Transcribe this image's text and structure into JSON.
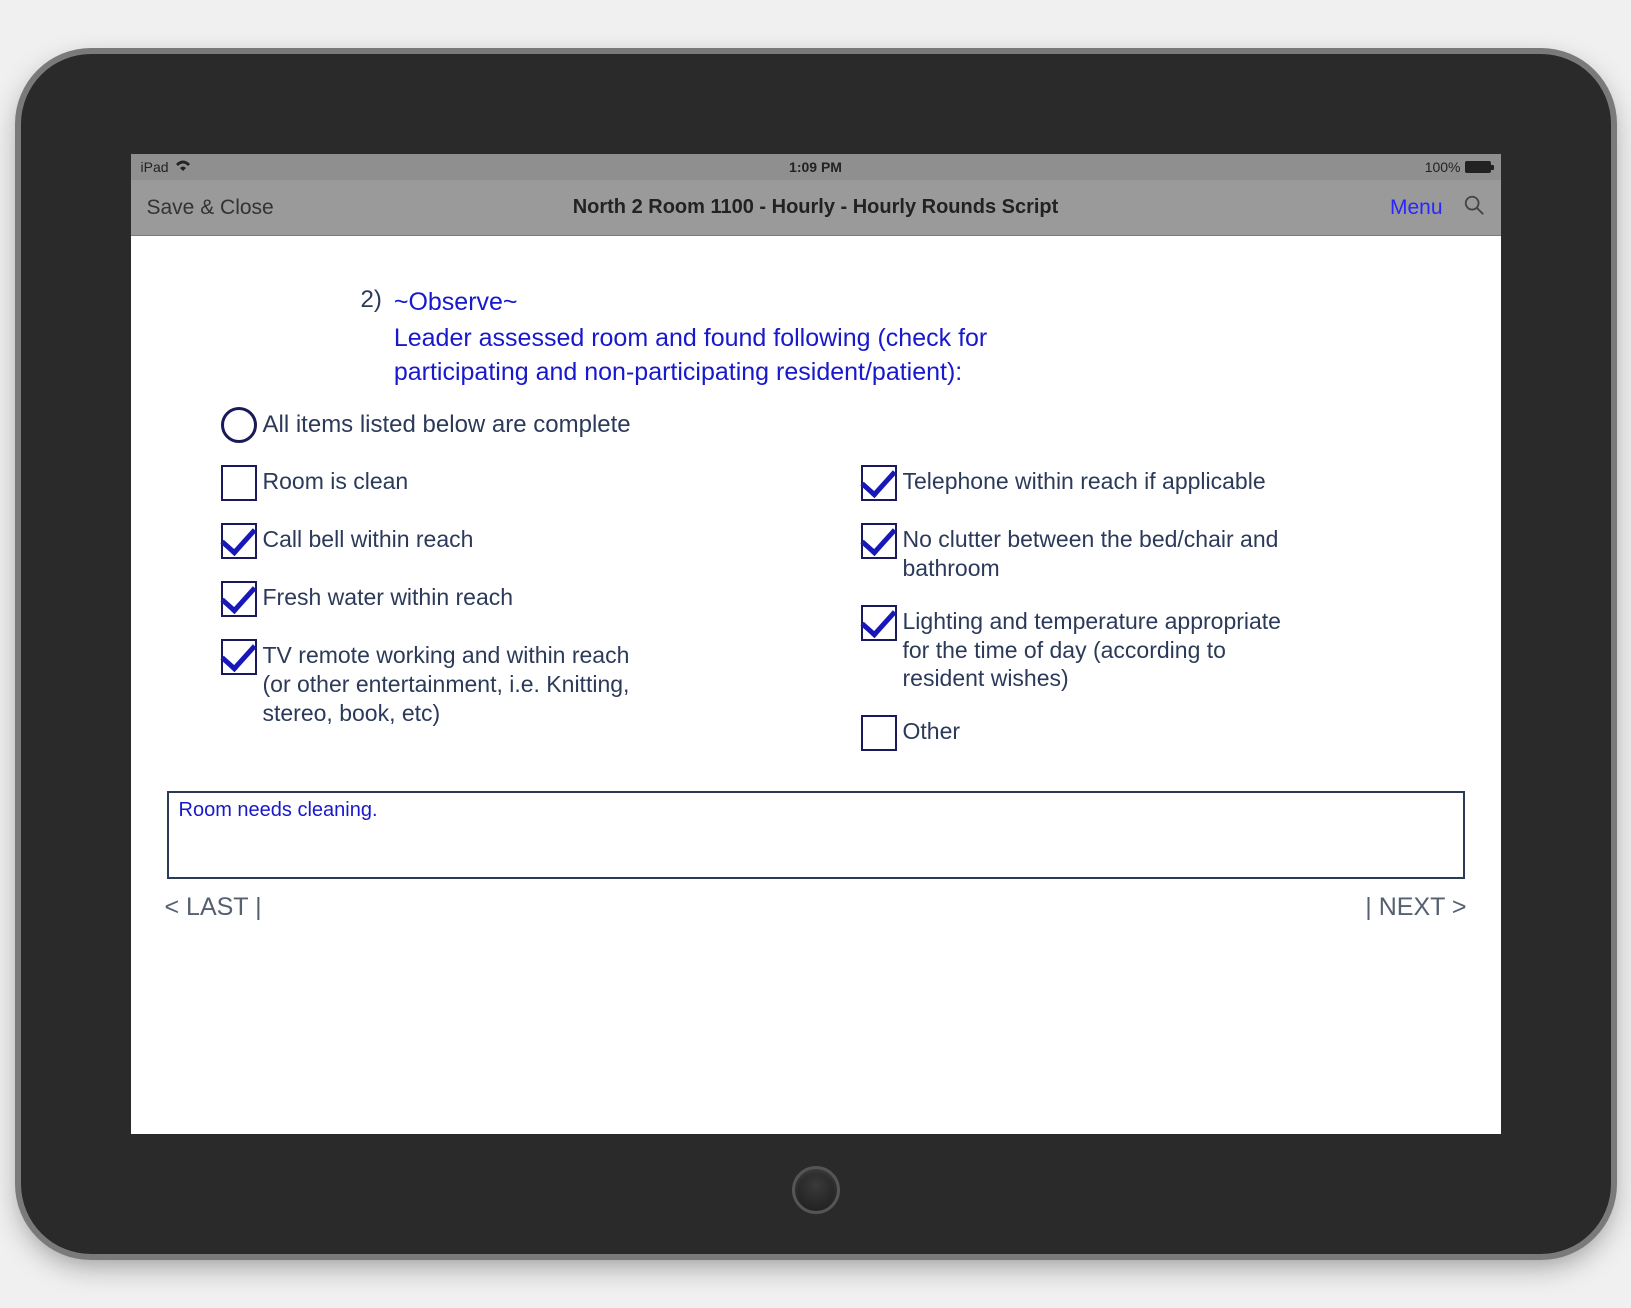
{
  "status": {
    "device": "iPad",
    "time": "1:09 PM",
    "battery": "100%"
  },
  "nav": {
    "save_close": "Save & Close",
    "title": "North 2 Room 1100  - Hourly - Hourly Rounds Script",
    "menu": "Menu"
  },
  "question": {
    "number": "2)",
    "heading": "~Observe~",
    "prompt": "Leader assessed room and found following (check for participating and non-participating resident/patient):"
  },
  "radio": {
    "all_complete": "All items listed below are complete",
    "checked": false
  },
  "checks_left": [
    {
      "label": "Room is clean",
      "checked": false
    },
    {
      "label": "Call bell within reach",
      "checked": true
    },
    {
      "label": "Fresh water within reach",
      "checked": true
    },
    {
      "label": "TV remote working and within reach (or other entertainment, i.e. Knitting, stereo, book, etc)",
      "checked": true
    }
  ],
  "checks_right": [
    {
      "label": "Telephone within reach if applicable",
      "checked": true
    },
    {
      "label": "No clutter between the bed/chair and bathroom",
      "checked": true
    },
    {
      "label": "Lighting and temperature appropriate for the time of day (according to resident wishes)",
      "checked": true
    },
    {
      "label": "Other",
      "checked": false
    }
  ],
  "notes": "Room needs cleaning.",
  "footer": {
    "last": "< LAST |",
    "next": "| NEXT >"
  }
}
